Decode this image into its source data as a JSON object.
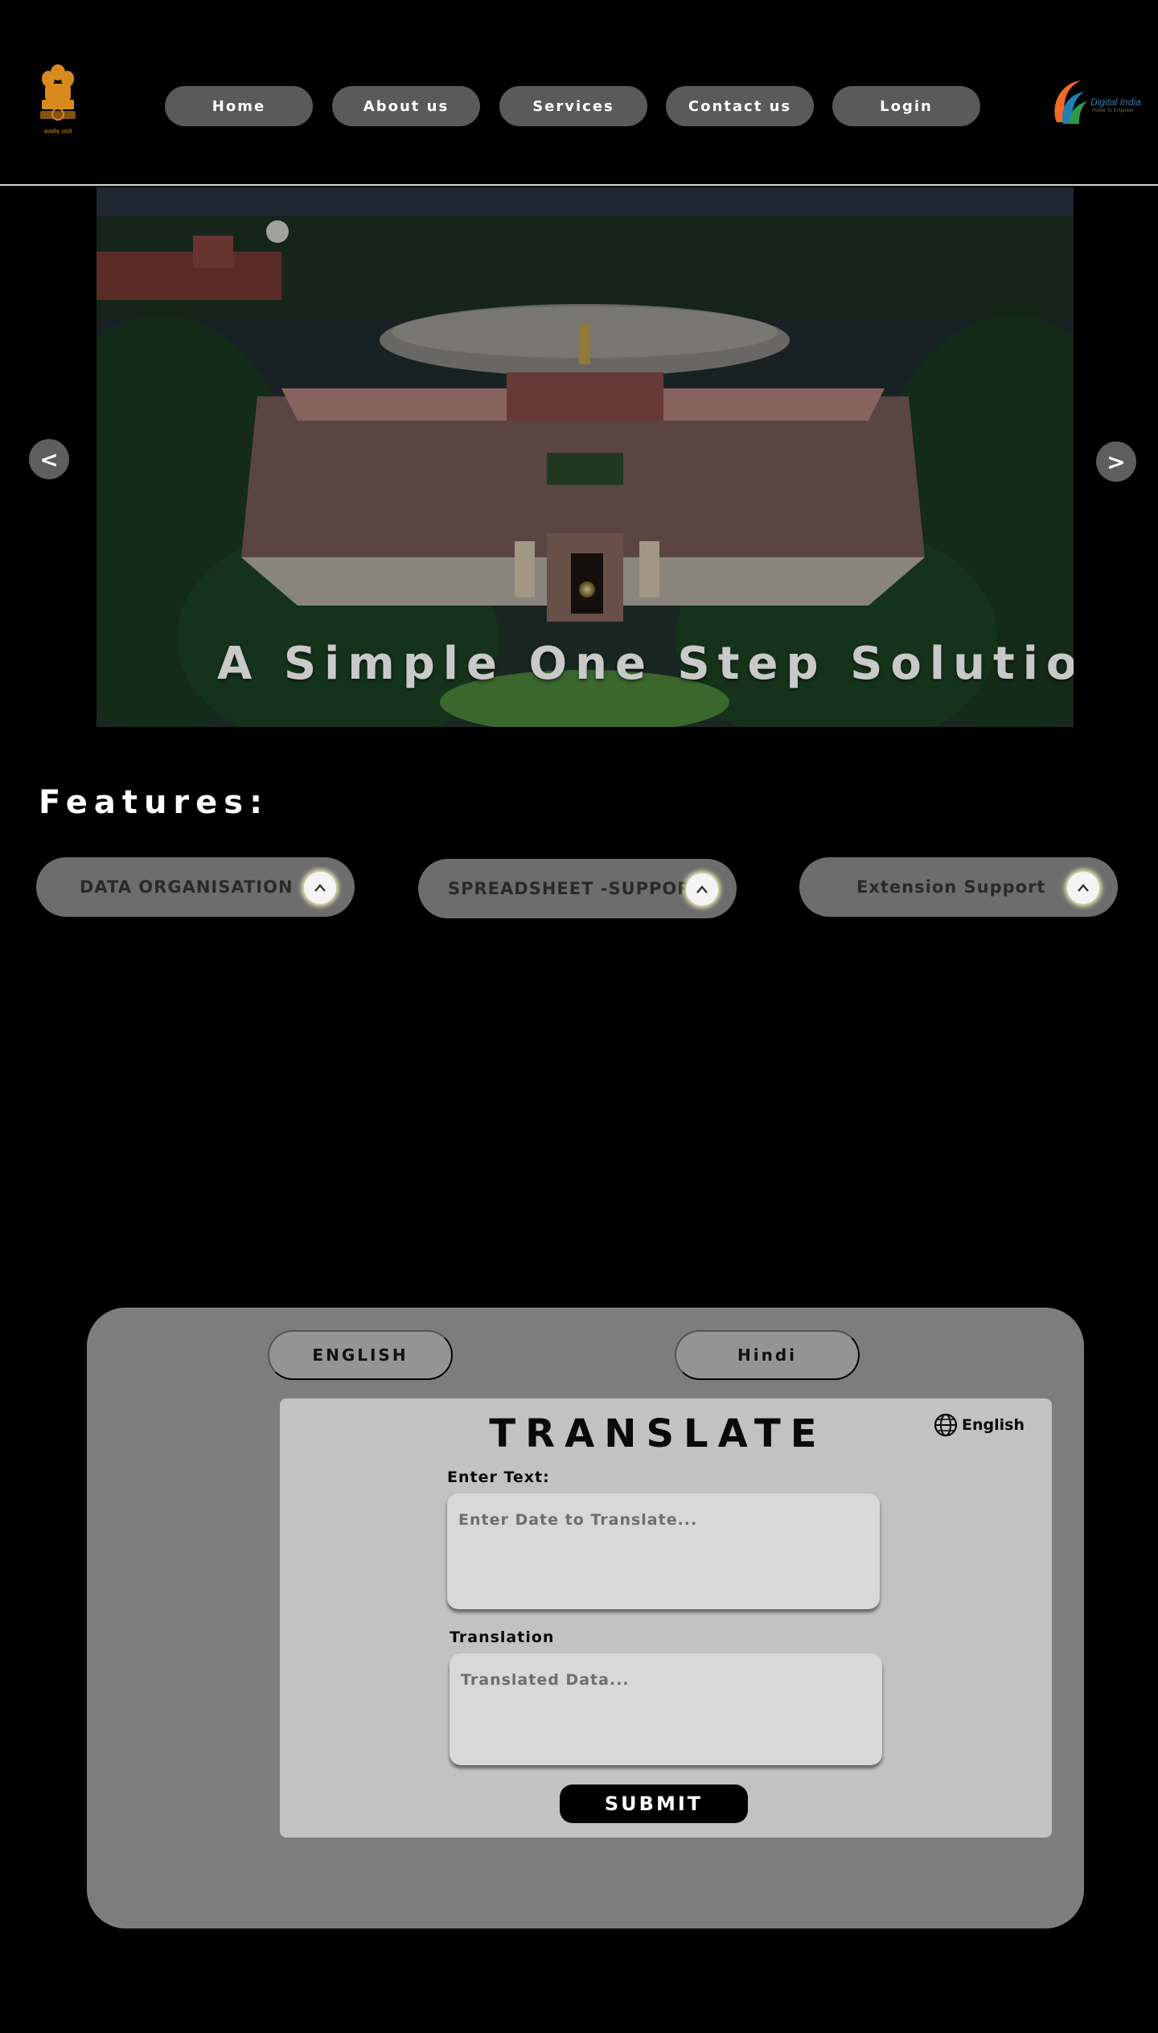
{
  "nav": {
    "items": [
      "Home",
      "About us",
      "Services",
      "Contact us",
      "Login"
    ]
  },
  "logos": {
    "emblem_motto": "सत्यमेव जयते",
    "digital_india": "Digital India",
    "digital_india_tagline": "Power To Empower"
  },
  "hero": {
    "tagline": "A Simple One Step Solution !!",
    "prev_label": "<",
    "next_label": ">"
  },
  "features": {
    "title": "Features:",
    "items": [
      {
        "label": "DATA ORGANISATION",
        "icon": "chevron-up-icon"
      },
      {
        "label": "SPREADSHEET -SUPPORT",
        "icon": "chevron-up-icon"
      },
      {
        "label": "Extension Support",
        "icon": "chevron-up-icon"
      }
    ]
  },
  "translate": {
    "lang_tabs": [
      "ENGLISH",
      "Hindi"
    ],
    "title": "TRANSLATE",
    "language_selector": "English",
    "language_icon": "globe-icon",
    "input_label": "Enter Text:",
    "input_placeholder": "Enter Date to Translate...",
    "output_label": "Translation",
    "output_placeholder": "Translated Data...",
    "submit_label": "SUBMIT"
  },
  "colors": {
    "background": "#000000",
    "nav_button": "#5a5a5a",
    "feature_pill": "#6d6d6d",
    "panel": "#7d7d7d",
    "card": "#c2c2c2",
    "field": "#d8d8d8",
    "emblem_gold": "#d88a1c"
  }
}
